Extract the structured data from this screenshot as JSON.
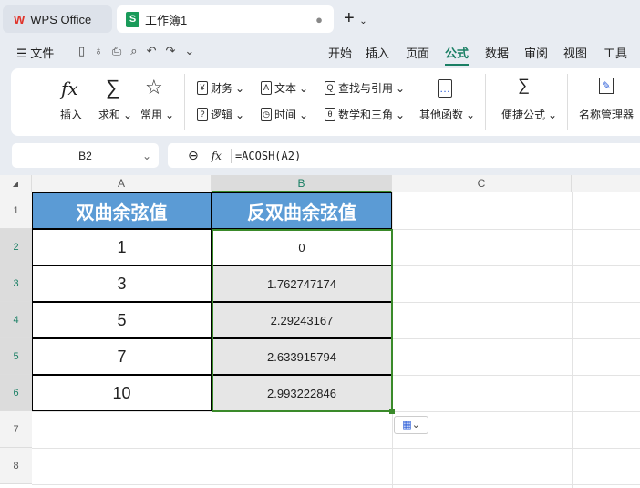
{
  "tabs": [
    {
      "label": "WPS Office"
    },
    {
      "label": "工作簿1",
      "icon": "S"
    }
  ],
  "menu": {
    "hamburger": "文件",
    "items": [
      "开始",
      "插入",
      "页面",
      "公式",
      "数据",
      "审阅",
      "视图",
      "工具"
    ],
    "active": "公式"
  },
  "ribbon": {
    "insert": "插入",
    "sum": "求和",
    "common": "常用",
    "finance": "财务",
    "text": "文本",
    "lookup": "查找与引用",
    "logic": "逻辑",
    "time": "时间",
    "math": "数学和三角",
    "other": "其他函数",
    "quick": "便捷公式",
    "names": "名称管理器"
  },
  "formula_bar": {
    "cell_ref": "B2",
    "fx": "fx",
    "formula": "=ACOSH(A2)"
  },
  "sheet": {
    "columns": [
      "A",
      "B",
      "C"
    ],
    "rows": [
      "1",
      "2",
      "3",
      "4",
      "5",
      "6",
      "7",
      "8"
    ],
    "headers": [
      "双曲余弦值",
      "反双曲余弦值"
    ],
    "data": [
      [
        "1",
        "0"
      ],
      [
        "3",
        "1.762747174"
      ],
      [
        "5",
        "2.29243167"
      ],
      [
        "7",
        "2.633915794"
      ],
      [
        "10",
        "2.993222846"
      ]
    ]
  },
  "colors": {
    "accent": "#1a7f64",
    "header_fill": "#5b9bd5",
    "selection": "#3a8a2a"
  }
}
